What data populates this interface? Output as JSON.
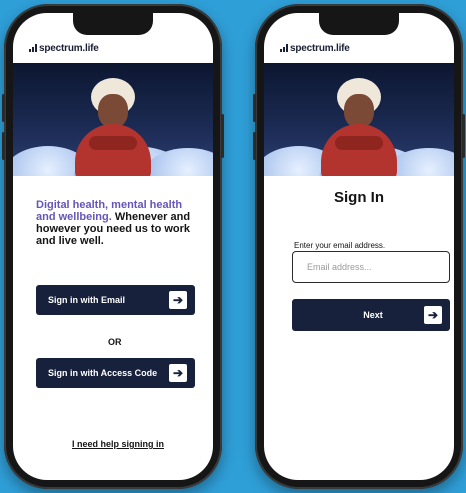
{
  "brand": {
    "name": "spectrum.life"
  },
  "left_screen": {
    "tagline_highlight": "Digital health, mental health and wellbeing.",
    "tagline_rest": " Whenever and however you need us to work and live well.",
    "buttons": [
      {
        "label": "Sign in with Email",
        "icon": "arrow-right-icon"
      },
      {
        "label": "Sign in with Access Code",
        "icon": "arrow-right-icon"
      }
    ],
    "or_label": "OR",
    "help_link": "I need help signing in"
  },
  "right_screen": {
    "title": "Sign In",
    "email_label": "Enter your email address.",
    "email_placeholder": "Email address...",
    "next_label": "Next",
    "next_icon": "arrow-right-icon"
  },
  "colors": {
    "background": "#2f9fd8",
    "button": "#18213b",
    "tagline_highlight": "#6555b8"
  }
}
